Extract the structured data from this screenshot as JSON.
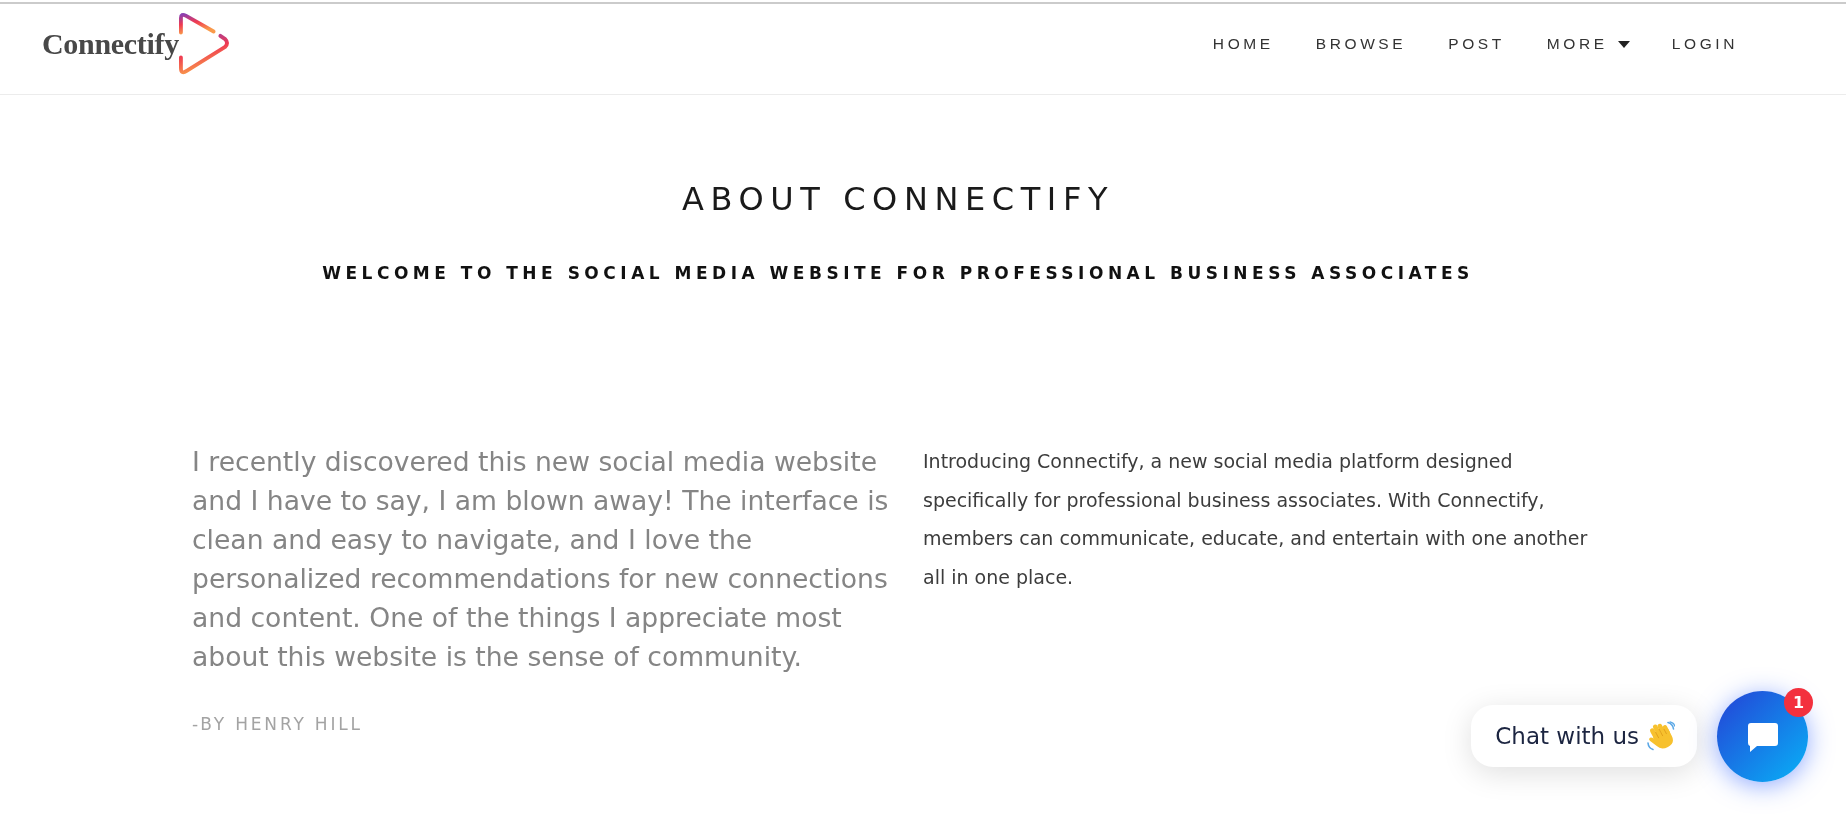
{
  "brand": {
    "name": "Connectify"
  },
  "nav": {
    "items": [
      {
        "label": "HOME",
        "kind": "link"
      },
      {
        "label": "BROWSE",
        "kind": "link"
      },
      {
        "label": "POST",
        "kind": "link"
      },
      {
        "label": "MORE",
        "kind": "dropdown"
      },
      {
        "label": "LOGIN",
        "kind": "link"
      }
    ]
  },
  "about": {
    "title": "ABOUT CONNECTIFY",
    "subtitle": "WELCOME TO THE SOCIAL MEDIA WEBSITE FOR PROFESSIONAL BUSINESS ASSOCIATES"
  },
  "testimonial": {
    "quote": "I recently discovered this new social media website and I have to say, I am blown away! The interface is clean and easy to navigate, and I love the personalized recommendations for new connections and content. One of the things I appreciate most about this website is the sense of community.",
    "author": "-BY HENRY HILL"
  },
  "intro": {
    "text": "Introducing Connectify, a new social media platform designed specifically for professional business associates. With Connectify, members can communicate, educate, and entertain with one another all in one place."
  },
  "chat": {
    "prompt": "Chat with us",
    "unread": "1"
  }
}
